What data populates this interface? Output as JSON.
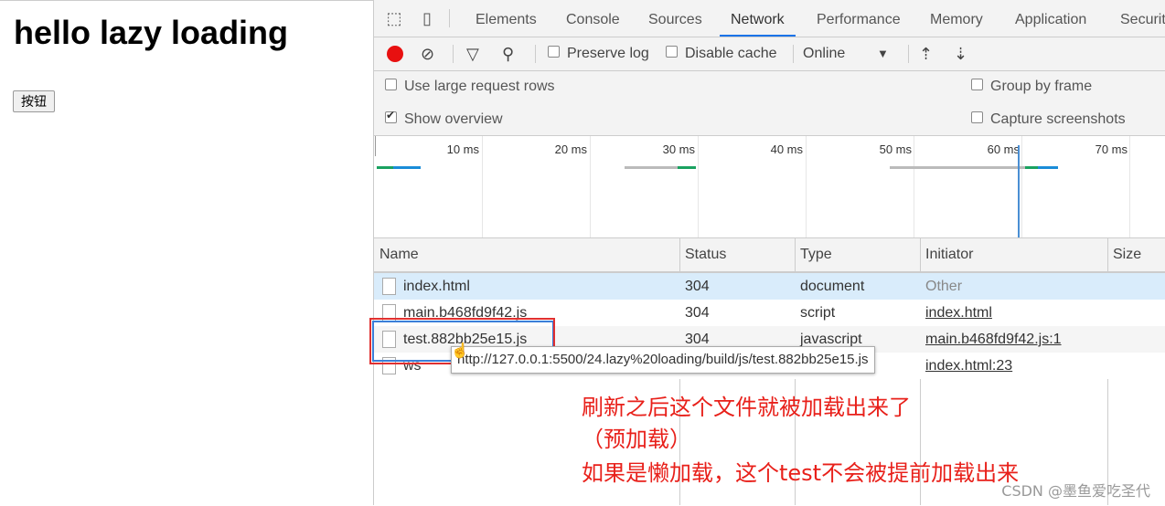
{
  "page": {
    "heading": "hello lazy loading",
    "button_label": "按钮"
  },
  "devtools": {
    "tabs": [
      {
        "label": "Elements"
      },
      {
        "label": "Console"
      },
      {
        "label": "Sources"
      },
      {
        "label": "Network",
        "active": true
      },
      {
        "label": "Performance"
      },
      {
        "label": "Memory"
      },
      {
        "label": "Application"
      },
      {
        "label": "Securit"
      }
    ],
    "toolbar": {
      "preserve_log": "Preserve log",
      "disable_cache": "Disable cache",
      "throttle": "Online"
    },
    "settings": {
      "large_rows": "Use large request rows",
      "show_overview": "Show overview",
      "group_by_frame": "Group by frame",
      "capture_screenshots": "Capture screenshots"
    },
    "overview_ticks": [
      "10 ms",
      "20 ms",
      "30 ms",
      "40 ms",
      "50 ms",
      "60 ms",
      "70 ms"
    ],
    "columns": [
      "Name",
      "Status",
      "Type",
      "Initiator",
      "Size"
    ],
    "rows": [
      {
        "name": "index.html",
        "status": "304",
        "type": "document",
        "initiator": "Other"
      },
      {
        "name": "main.b468fd9f42.js",
        "status": "304",
        "type": "script",
        "initiator": "index.html"
      },
      {
        "name": "test.882bb25e15.js",
        "status": "304",
        "type": "javascript",
        "initiator": "main.b468fd9f42.js:1"
      },
      {
        "name": "ws",
        "status": "",
        "type": "",
        "initiator": "index.html:23"
      }
    ],
    "tooltip": "http://127.0.0.1:5500/24.lazy%20loading/build/js/test.882bb25e15.js"
  },
  "annotation": {
    "line1": "刷新之后这个文件就被加载出来了",
    "line2": "（预加载）",
    "line3": "如果是懒加载，这个test不会被提前加载出来"
  },
  "watermark": "CSDN @墨鱼爱吃圣代",
  "colors": {
    "record": "#e81010",
    "active_tab": "#1a73e8",
    "annotation": "#e8201a",
    "highlight_box": "#e03030"
  }
}
